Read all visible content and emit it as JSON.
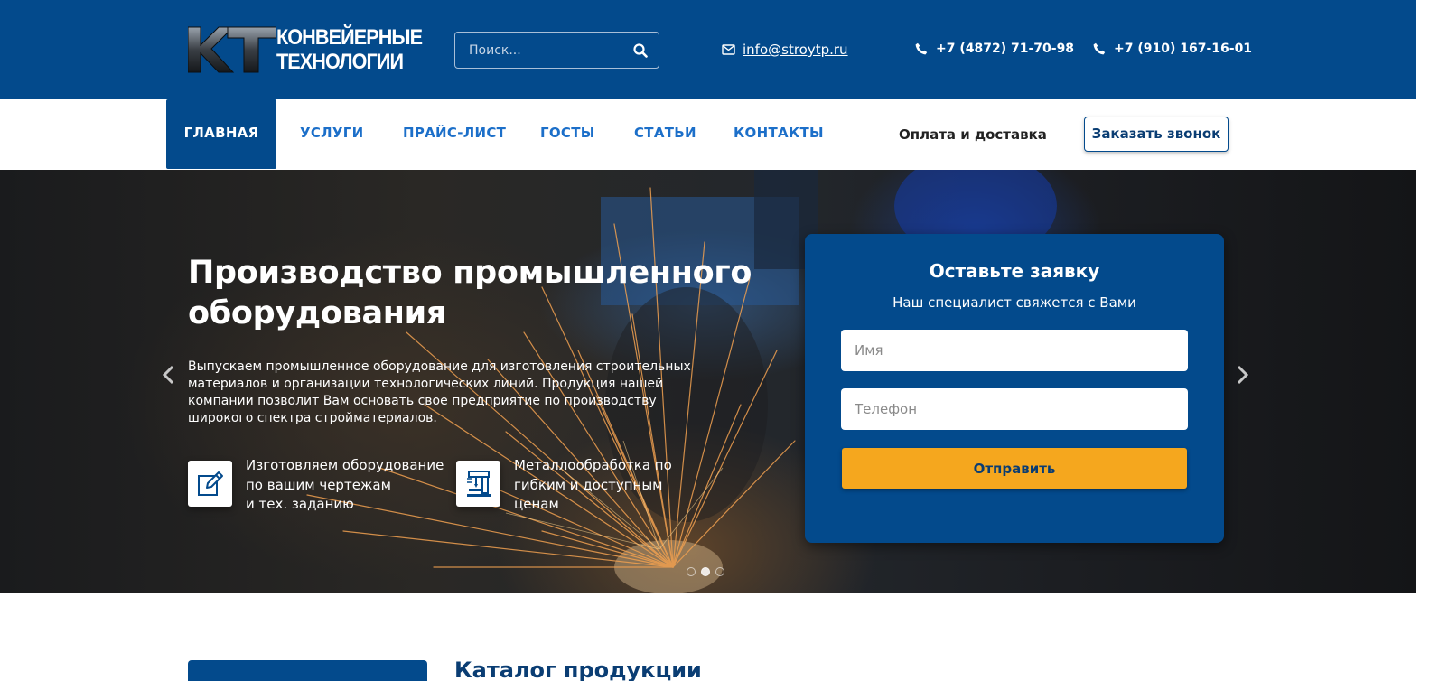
{
  "header": {
    "logo": {
      "mark": "КТ",
      "line1": "КОНВЕЙЕРНЫЕ",
      "line2": "ТЕХНОЛОГИИ"
    },
    "search": {
      "placeholder": "Поиск...",
      "value": "",
      "icon": "search-icon"
    },
    "email": {
      "icon": "envelope-icon",
      "text": "info@stroytp.ru"
    },
    "phone1": {
      "icon": "phone-icon",
      "text": "+7 (4872) 71-70-98"
    },
    "phone2": {
      "icon": "phone-icon",
      "text": "+7 (910) 167-16-01"
    }
  },
  "nav": {
    "items": [
      {
        "label": "ГЛАВНАЯ",
        "active": true
      },
      {
        "label": "УСЛУГИ",
        "active": false
      },
      {
        "label": "ПРАЙС-ЛИСТ",
        "active": false
      },
      {
        "label": "ГОСТЫ",
        "active": false
      },
      {
        "label": "СТАТЬИ",
        "active": false
      },
      {
        "label": "КОНТАКТЫ",
        "active": false
      }
    ],
    "payment_link": "Оплата и доставка",
    "callback_button": "Заказать звонок"
  },
  "hero": {
    "title": "Производство промышленного оборудования",
    "description": "Выпускаем промышленное оборудование для изготовления строительных материалов и организации технологических линий. Продукция нашей компании позволит Вам основать свое предприятие по производству широкого спектра стройматериалов.",
    "features": [
      {
        "icon": "edit-icon",
        "text": "Изготовляем оборудование\nпо вашим чертежам\nи тех. заданию"
      },
      {
        "icon": "drill-press-icon",
        "text": "Металлообработка по\nгибким и доступным\nценам"
      }
    ],
    "slides": {
      "count": 3,
      "active_index": 1
    },
    "prev_icon": "chevron-left-icon",
    "next_icon": "chevron-right-icon"
  },
  "form": {
    "title": "Оставьте заявку",
    "subtitle": "Наш специалист свяжется с Вами",
    "name_placeholder": "Имя",
    "phone_placeholder": "Телефон",
    "submit_label": "Отправить"
  },
  "catalog": {
    "title": "Каталог продукции"
  },
  "colors": {
    "brand_blue": "#034a8c",
    "link_blue": "#1c6fc9",
    "accent_orange": "#f5a71e"
  }
}
